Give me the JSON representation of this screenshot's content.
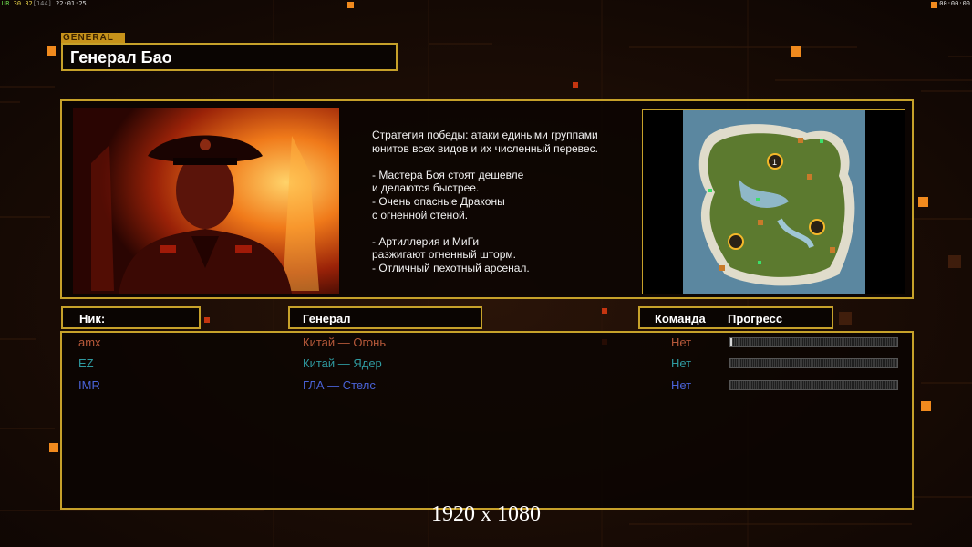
{
  "status_bar": {
    "left": {
      "a": "ЦR",
      "b": "30",
      "c": "32",
      "d": "[144]",
      "e": "22:01:25"
    },
    "right": "00:00:00"
  },
  "header": {
    "tag": "GENERAL",
    "title": "Генерал Бао"
  },
  "info": {
    "portrait_icon": "general-portrait",
    "description": "Стратегия победы: атаки едиными группами\nюнитов всех видов и их численный перевес.\n\n- Мастера Боя стоят дешевле\nи делаются быстрее.\n- Очень опасные Драконы\nс огненной стеной.\n\n- Артиллерия и МиГи\nразжигают огненный шторм.\n- Отличный пехотный арсенал.",
    "map_start_marker": "1"
  },
  "columns": {
    "nick": "Ник:",
    "general": "Генерал",
    "team": "Команда",
    "progress": "Прогресс"
  },
  "players": [
    {
      "nick": "amx",
      "general": "Китай — Огонь",
      "team": "Нет",
      "color": "#b7593a",
      "progress": 0.01
    },
    {
      "nick": "EZ",
      "general": "Китай — Ядер",
      "team": "Нет",
      "color": "#2f9aa0",
      "progress": 0
    },
    {
      "nick": "IMR",
      "general": "ГЛА — Стелс",
      "team": "Нет",
      "color": "#4a63d8",
      "progress": 0
    }
  ],
  "resolution_label": "1920 x 1080",
  "colors": {
    "border": "#c6a12a",
    "accent_orange": "#f08a1e"
  }
}
